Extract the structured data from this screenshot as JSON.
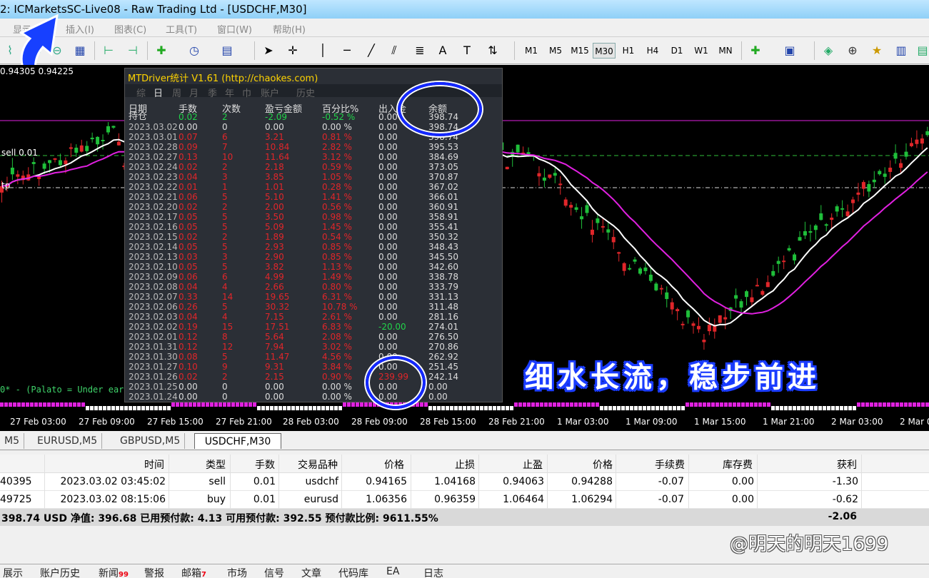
{
  "window": {
    "title": "2: ICMarketsSC-Live08 - Raw Trading Ltd - [USDCHF,M30]"
  },
  "menu": [
    "显示(V)",
    "插入(I)",
    "图表(C)",
    "工具(T)",
    "窗口(W)",
    "帮助(H)"
  ],
  "timeframes": [
    "M1",
    "M5",
    "M15",
    "M30",
    "H1",
    "H4",
    "D1",
    "W1",
    "MN"
  ],
  "active_timeframe": "M30",
  "chart": {
    "quote": "0.94305 0.94225",
    "sell_label": "sell 0.01",
    "tp_label": "tp",
    "indicator_text": "0* - (Palato = Under eart",
    "slogan": "细水长流，稳步前进",
    "time_axis": [
      "27 Feb 03:00",
      "27 Feb 09:00",
      "27 Feb 15:00",
      "27 Feb 21:00",
      "28 Feb 03:00",
      "28 Feb 09:00",
      "28 Feb 15:00",
      "28 Feb 21:00",
      "1 Mar 03:00",
      "1 Mar 09:00",
      "1 Mar 15:00",
      "1 Mar 21:00",
      "2 Mar 03:00",
      "2 Mar 0"
    ],
    "colors": {
      "up": "#1fbf3a",
      "down": "#e0262a",
      "ma_fast": "#ffffff",
      "ma_slow": "#e020e0",
      "level": "#e020e0"
    }
  },
  "mtdriver": {
    "title": "MTDriver统计 V1.61  (http://chaokes.com)",
    "tabs": [
      "综",
      "日",
      "周",
      "月",
      "季",
      "年",
      "巾",
      "账户",
      "历史"
    ],
    "active_tab": "日",
    "headers": [
      "日期",
      "手数",
      "次数",
      "盈亏金额",
      "百分比%",
      "出入金",
      "余额"
    ],
    "position": {
      "label": "持仓",
      "lots": "0.02",
      "count": "2",
      "pnl": "-2.09",
      "pct": "-0.52 %",
      "io": "0.00",
      "balance": "398.74"
    },
    "rows": [
      [
        "2023.03.02",
        "0.00",
        "0",
        "0.00",
        "0.00 %",
        "0.00",
        "398.74"
      ],
      [
        "2023.03.01",
        "0.07",
        "6",
        "3.21",
        "0.81 %",
        "0.00",
        "398.74"
      ],
      [
        "2023.02.28",
        "0.09",
        "7",
        "10.84",
        "2.82 %",
        "0.00",
        "395.53"
      ],
      [
        "2023.02.27",
        "0.13",
        "10",
        "11.64",
        "3.12 %",
        "0.00",
        "384.69"
      ],
      [
        "2023.02.24",
        "0.02",
        "2",
        "2.18",
        "0.59 %",
        "0.00",
        "373.05"
      ],
      [
        "2023.02.23",
        "0.04",
        "3",
        "3.85",
        "1.05 %",
        "0.00",
        "370.87"
      ],
      [
        "2023.02.22",
        "0.01",
        "1",
        "1.01",
        "0.28 %",
        "0.00",
        "367.02"
      ],
      [
        "2023.02.21",
        "0.06",
        "5",
        "5.10",
        "1.41 %",
        "0.00",
        "366.01"
      ],
      [
        "2023.02.20",
        "0.02",
        "2",
        "2.00",
        "0.56 %",
        "0.00",
        "360.91"
      ],
      [
        "2023.02.17",
        "0.05",
        "5",
        "3.50",
        "0.98 %",
        "0.00",
        "358.91"
      ],
      [
        "2023.02.16",
        "0.05",
        "5",
        "5.09",
        "1.45 %",
        "0.00",
        "355.41"
      ],
      [
        "2023.02.15",
        "0.02",
        "2",
        "1.89",
        "0.54 %",
        "0.00",
        "350.32"
      ],
      [
        "2023.02.14",
        "0.05",
        "5",
        "2.93",
        "0.85 %",
        "0.00",
        "348.43"
      ],
      [
        "2023.02.13",
        "0.03",
        "3",
        "2.90",
        "0.85 %",
        "0.00",
        "345.50"
      ],
      [
        "2023.02.10",
        "0.05",
        "5",
        "3.82",
        "1.13 %",
        "0.00",
        "342.60"
      ],
      [
        "2023.02.09",
        "0.06",
        "6",
        "4.99",
        "1.49 %",
        "0.00",
        "338.78"
      ],
      [
        "2023.02.08",
        "0.04",
        "4",
        "2.66",
        "0.80 %",
        "0.00",
        "333.79"
      ],
      [
        "2023.02.07",
        "0.33",
        "14",
        "19.65",
        "6.31 %",
        "0.00",
        "331.13"
      ],
      [
        "2023.02.06",
        "0.26",
        "5",
        "30.32",
        "10.78 %",
        "0.00",
        "311.48"
      ],
      [
        "2023.02.03",
        "0.04",
        "4",
        "7.15",
        "2.61 %",
        "0.00",
        "281.16"
      ],
      [
        "2023.02.02",
        "0.19",
        "15",
        "17.51",
        "6.83 %",
        "-20.00",
        "274.01"
      ],
      [
        "2023.02.01",
        "0.12",
        "8",
        "5.64",
        "2.08 %",
        "0.00",
        "276.50"
      ],
      [
        "2023.01.31",
        "0.12",
        "12",
        "7.94",
        "3.02 %",
        "0.00",
        "270.86"
      ],
      [
        "2023.01.30",
        "0.08",
        "5",
        "11.47",
        "4.56 %",
        "0.00",
        "262.92"
      ],
      [
        "2023.01.27",
        "0.10",
        "9",
        "9.31",
        "3.84 %",
        "0.00",
        "251.45"
      ],
      [
        "2023.01.26",
        "0.02",
        "2",
        "2.15",
        "0.90 %",
        "239.99",
        "242.14"
      ],
      [
        "2023.01.25",
        "0.00",
        "0",
        "0.00",
        "0.00 %",
        "0.00",
        "0.00"
      ],
      [
        "2023.01.24",
        "0.00",
        "0",
        "0.00",
        "0.00 %",
        "0.00",
        "0.00"
      ]
    ]
  },
  "symbol_tabs": [
    "M5",
    "EURUSD,M5",
    "GBPUSD,M5",
    "USDCHF,M30"
  ],
  "active_symbol_tab": "USDCHF,M30",
  "trades": {
    "headers": [
      "时间",
      "类型",
      "手数",
      "交易品种",
      "价格",
      "止损",
      "止盈",
      "价格",
      "手续费",
      "库存费",
      "获利"
    ],
    "rows": [
      [
        "40395",
        "2023.03.02 03:45:02",
        "sell",
        "0.01",
        "usdchf",
        "0.94165",
        "1.04168",
        "0.94063",
        "0.94288",
        "-0.07",
        "0.00",
        "-1.30"
      ],
      [
        "49725",
        "2023.03.02 08:15:06",
        "buy",
        "0.01",
        "eurusd",
        "1.06356",
        "0.96359",
        "1.06464",
        "1.06294",
        "-0.07",
        "0.00",
        "-0.62"
      ]
    ],
    "summary": "398.74 USD  净值: 396.68  已用预付款: 4.13  可用预付款: 392.55  预付款比例: 9611.55%",
    "summary_profit": "-2.06"
  },
  "watermark": "@明天的明天1699",
  "terminal_tabs": [
    {
      "label": "展示",
      "badge": ""
    },
    {
      "label": "账户历史",
      "badge": ""
    },
    {
      "label": "新闻",
      "badge": "99"
    },
    {
      "label": "警报",
      "badge": ""
    },
    {
      "label": "邮箱",
      "badge": "7"
    },
    {
      "label": "市场",
      "badge": ""
    },
    {
      "label": "信号",
      "badge": ""
    },
    {
      "label": "文章",
      "badge": ""
    },
    {
      "label": "代码库",
      "badge": ""
    },
    {
      "label": "EA",
      "badge": ""
    },
    {
      "label": "日志",
      "badge": ""
    }
  ]
}
